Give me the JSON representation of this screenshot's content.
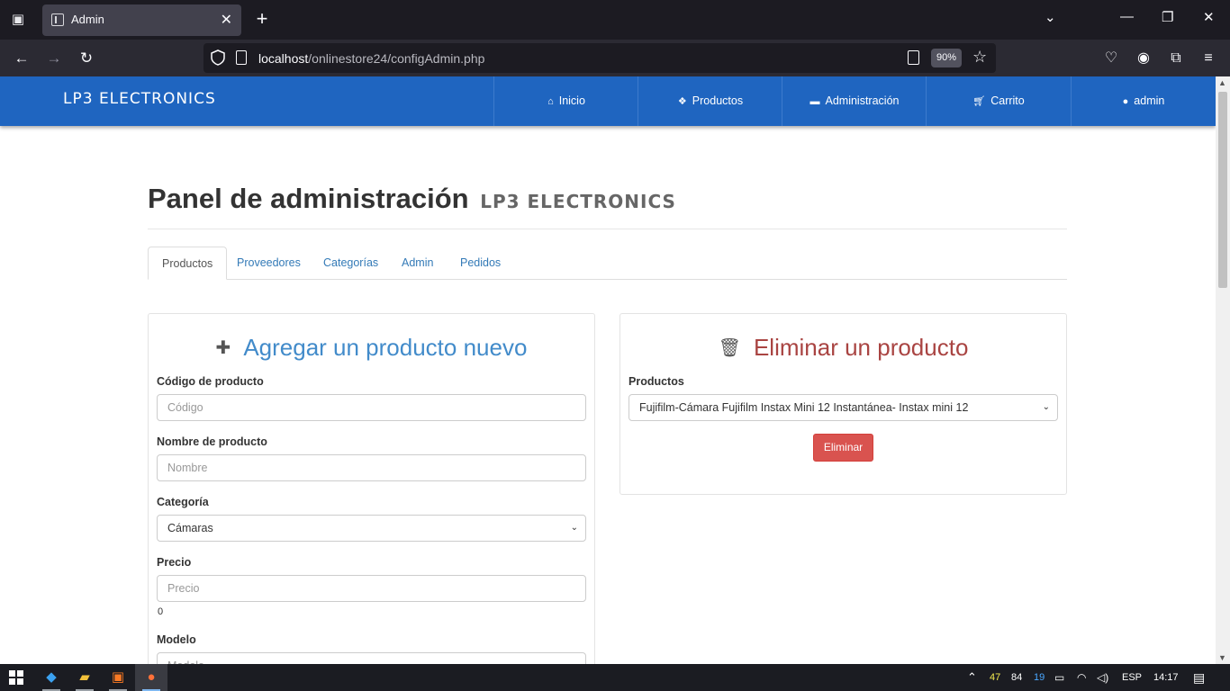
{
  "browser": {
    "tab_title": "Admin",
    "url_host": "localhost",
    "url_path": "/onlinestore24/configAdmin.php",
    "zoom": "90%"
  },
  "site": {
    "brand": "LP3 ELECTRONICS",
    "accent_color": "#1f65c0",
    "menu": [
      {
        "label": "Inicio",
        "icon": "home-icon"
      },
      {
        "label": "Productos",
        "icon": "dropbox-icon"
      },
      {
        "label": "Administración",
        "icon": "briefcase-icon"
      },
      {
        "label": "Carrito",
        "icon": "cart-icon"
      },
      {
        "label": "admin",
        "icon": "user-icon"
      }
    ]
  },
  "page": {
    "title": "Panel de administración",
    "title_brand": "LP3 ELECTRONICS",
    "tabs": [
      {
        "label": "Productos",
        "active": true
      },
      {
        "label": "Proveedores",
        "active": false
      },
      {
        "label": "Categorías",
        "active": false
      },
      {
        "label": "Admin",
        "active": false
      },
      {
        "label": "Pedidos",
        "active": false
      }
    ]
  },
  "add_panel": {
    "heading": "Agregar un producto nuevo",
    "heading_icon": "plus-icon",
    "code_label": "Código de producto",
    "code_placeholder": "Código",
    "name_label": "Nombre de producto",
    "name_placeholder": "Nombre",
    "category_label": "Categoría",
    "category_value": "Cámaras",
    "price_label": "Precio",
    "price_placeholder": "Precio",
    "price_note": "0",
    "model_label": "Modelo",
    "model_placeholder": "Modelo"
  },
  "delete_panel": {
    "heading": "Eliminar un producto",
    "heading_icon": "trash-icon",
    "products_label": "Productos",
    "products_value": "Fujifilm-Cámara Fujifilm Instax Mini 12 Instantánea- Instax mini 12",
    "delete_button": "Eliminar",
    "danger_color": "#d9534f"
  },
  "taskbar": {
    "tray_temp1": "47",
    "tray_temp2": "84",
    "tray_temp3": "19",
    "language": "ESP",
    "time": "14:17"
  }
}
